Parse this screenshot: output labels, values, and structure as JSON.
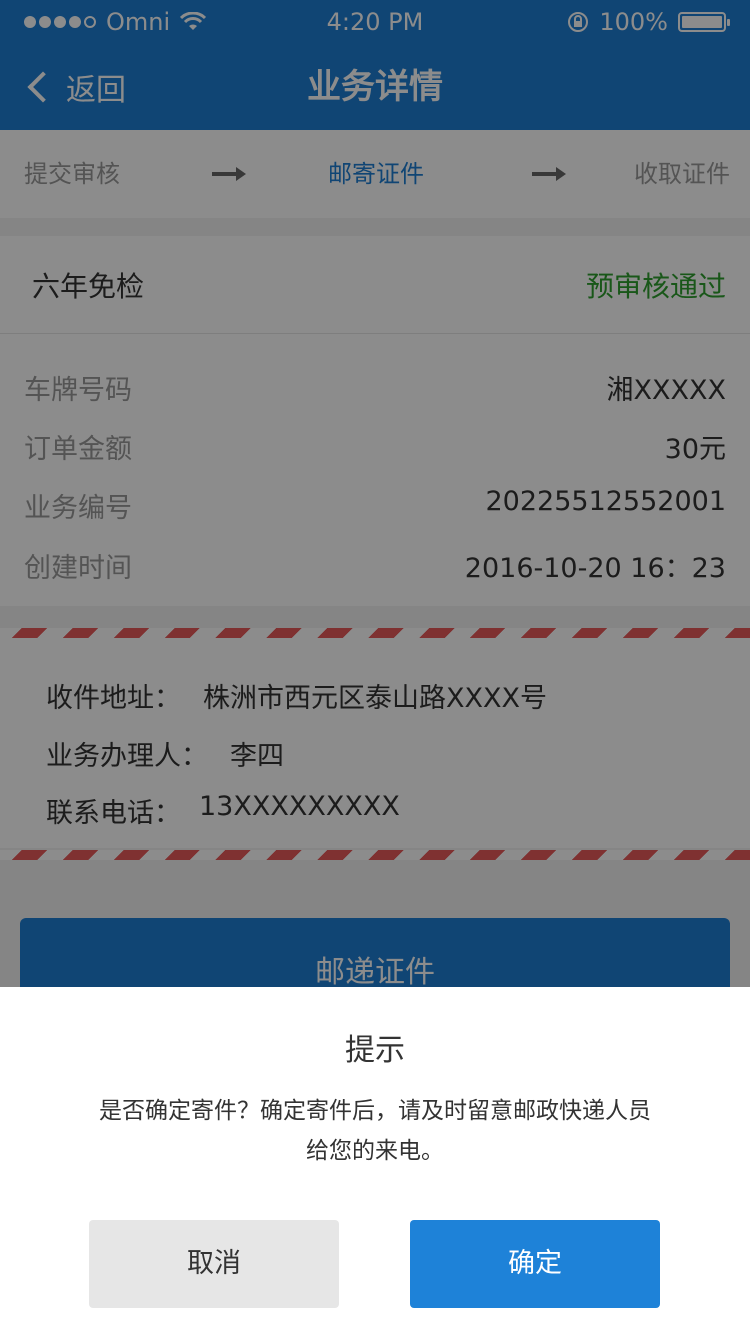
{
  "status_bar": {
    "carrier": "Omni",
    "time": "4:20 PM",
    "battery": "100%",
    "icons": [
      "signal-dots-icon",
      "wifi-icon",
      "rotation-lock-icon",
      "battery-icon"
    ]
  },
  "nav": {
    "back_label": "返回",
    "title": "业务详情"
  },
  "steps": [
    {
      "label": "提交审核",
      "active": false
    },
    {
      "label": "邮寄证件",
      "active": true
    },
    {
      "label": "收取证件",
      "active": false
    }
  ],
  "business": {
    "name": "六年免检",
    "status": "预审核通过",
    "status_color": "#2e9e2e",
    "fields": [
      {
        "label": "车牌号码",
        "value": "湘XXXXX"
      },
      {
        "label": "订单金额",
        "value": "30元"
      },
      {
        "label": "业务编号",
        "value": "20225512552001"
      },
      {
        "label": "创建时间",
        "value": "2016-10-20 16：23"
      }
    ]
  },
  "delivery": {
    "address_label": "收件地址：",
    "address": "株洲市西元区泰山路XXXX号",
    "handler_label": "业务办理人：",
    "handler": "李四",
    "phone_label": "联系电话：",
    "phone": "13XXXXXXXXX"
  },
  "primary_button": "邮递证件",
  "dialog": {
    "title": "提示",
    "message": "是否确定寄件？确定寄件后，请及时留意邮政快递人员给您的来电。",
    "cancel": "取消",
    "confirm": "确定"
  },
  "colors": {
    "brand_blue": "#1e7fd4",
    "stripe_red": "#e85a5a"
  }
}
